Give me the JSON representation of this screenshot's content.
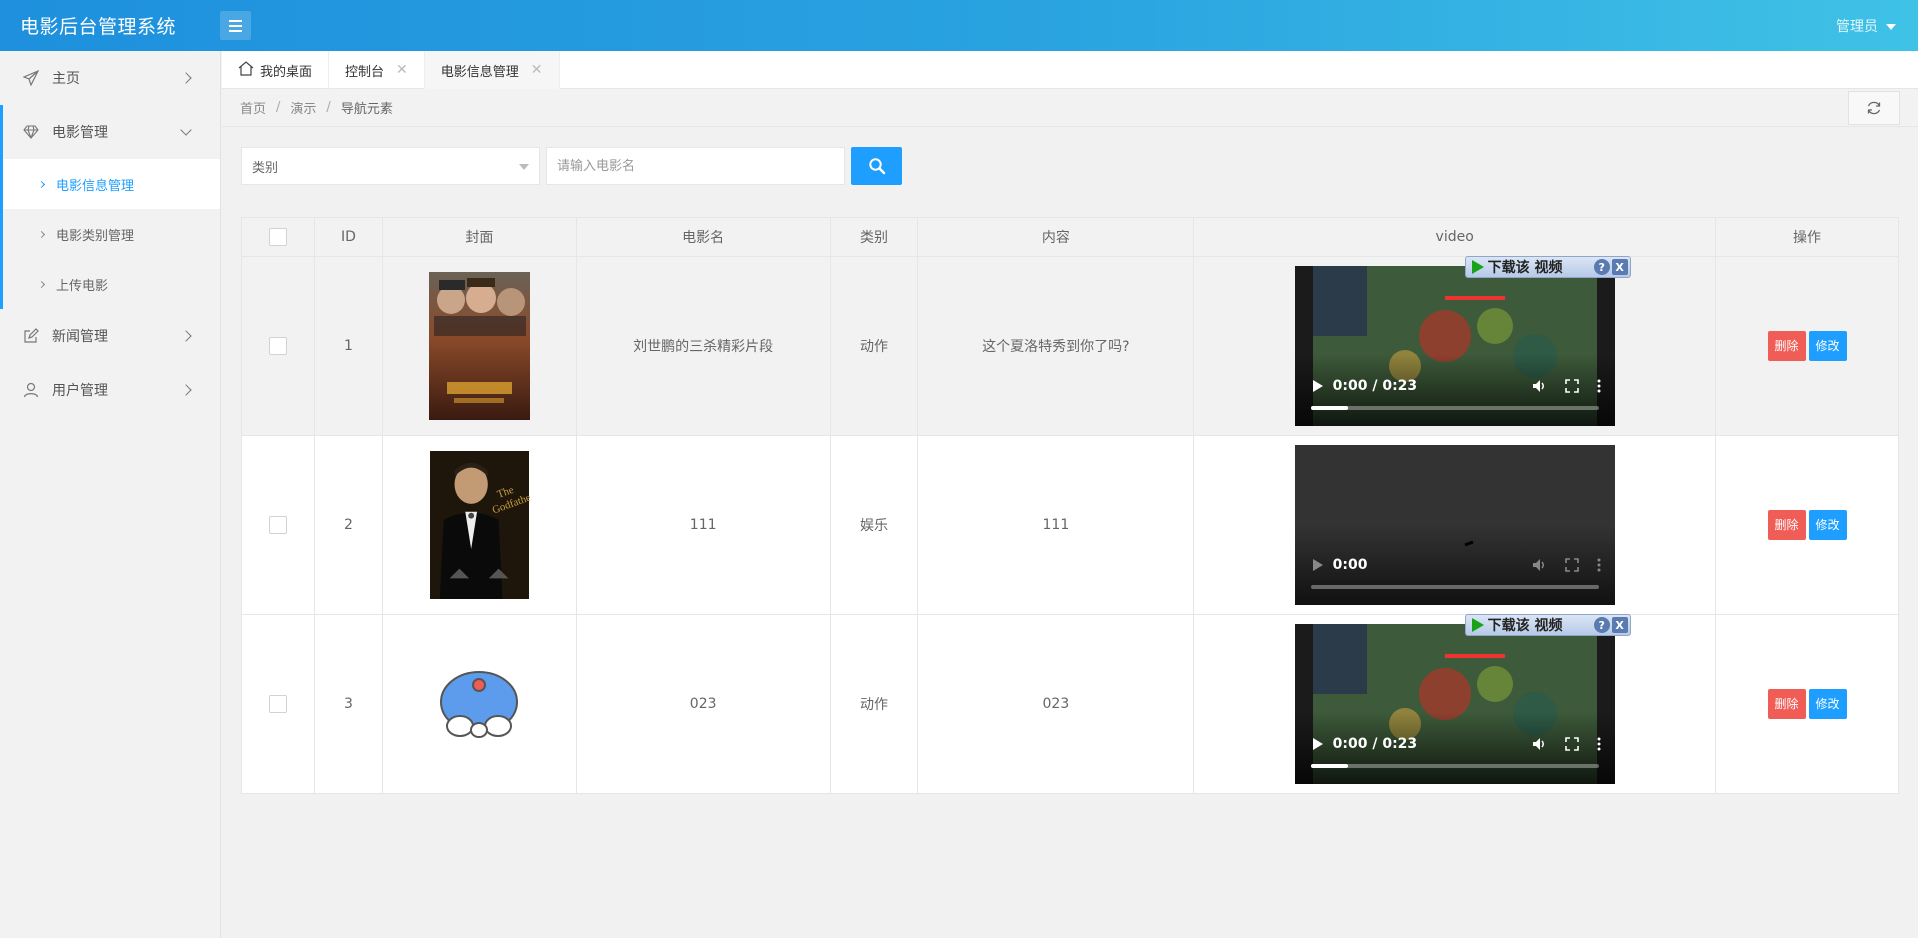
{
  "header": {
    "title": "电影后台管理系统",
    "user": "管理员"
  },
  "sidebar": {
    "items": [
      {
        "label": "主页",
        "icon": "paper-plane-icon"
      },
      {
        "label": "电影管理",
        "icon": "diamond-icon",
        "expanded": true,
        "children": [
          {
            "label": "电影信息管理",
            "active": true
          },
          {
            "label": "电影类别管理"
          },
          {
            "label": "上传电影"
          }
        ]
      },
      {
        "label": "新闻管理",
        "icon": "edit-icon"
      },
      {
        "label": "用户管理",
        "icon": "user-icon"
      }
    ]
  },
  "tabs": [
    {
      "label": "我的桌面",
      "icon": "home-icon"
    },
    {
      "label": "控制台",
      "closable": true
    },
    {
      "label": "电影信息管理",
      "closable": true,
      "active": true
    }
  ],
  "breadcrumb": [
    "首页",
    "演示",
    "导航元素"
  ],
  "filter": {
    "category_placeholder": "类别",
    "search_placeholder": "请输入电影名"
  },
  "table": {
    "columns": [
      "ID",
      "封面",
      "电影名",
      "类别",
      "内容",
      "video",
      "操作"
    ],
    "rows": [
      {
        "id": "1",
        "name": "刘世鹏的三杀精彩片段",
        "category": "动作",
        "content": "这个夏洛特秀到你了吗?",
        "video_time": "0:00 / 0:23",
        "video_progress": 0.13,
        "has_download_bar": true,
        "poster": "war-poster"
      },
      {
        "id": "2",
        "name": "111",
        "category": "娱乐",
        "content": "111",
        "video_time": "0:00",
        "video_progress": 0,
        "has_download_bar": false,
        "poster": "godfather-poster"
      },
      {
        "id": "3",
        "name": "023",
        "category": "动作",
        "content": "023",
        "video_time": "0:00 / 0:23",
        "video_progress": 0.13,
        "has_download_bar": true,
        "poster": "cartoon-icon"
      }
    ],
    "delete_label": "删除",
    "edit_label": "修改"
  },
  "download_bar": {
    "label": "下载该 视频",
    "help": "?",
    "close": "X"
  },
  "colors": {
    "accent": "#1e9fff",
    "danger": "#f05c56",
    "header_start": "#1e90dd",
    "header_end": "#3fc2e6"
  }
}
